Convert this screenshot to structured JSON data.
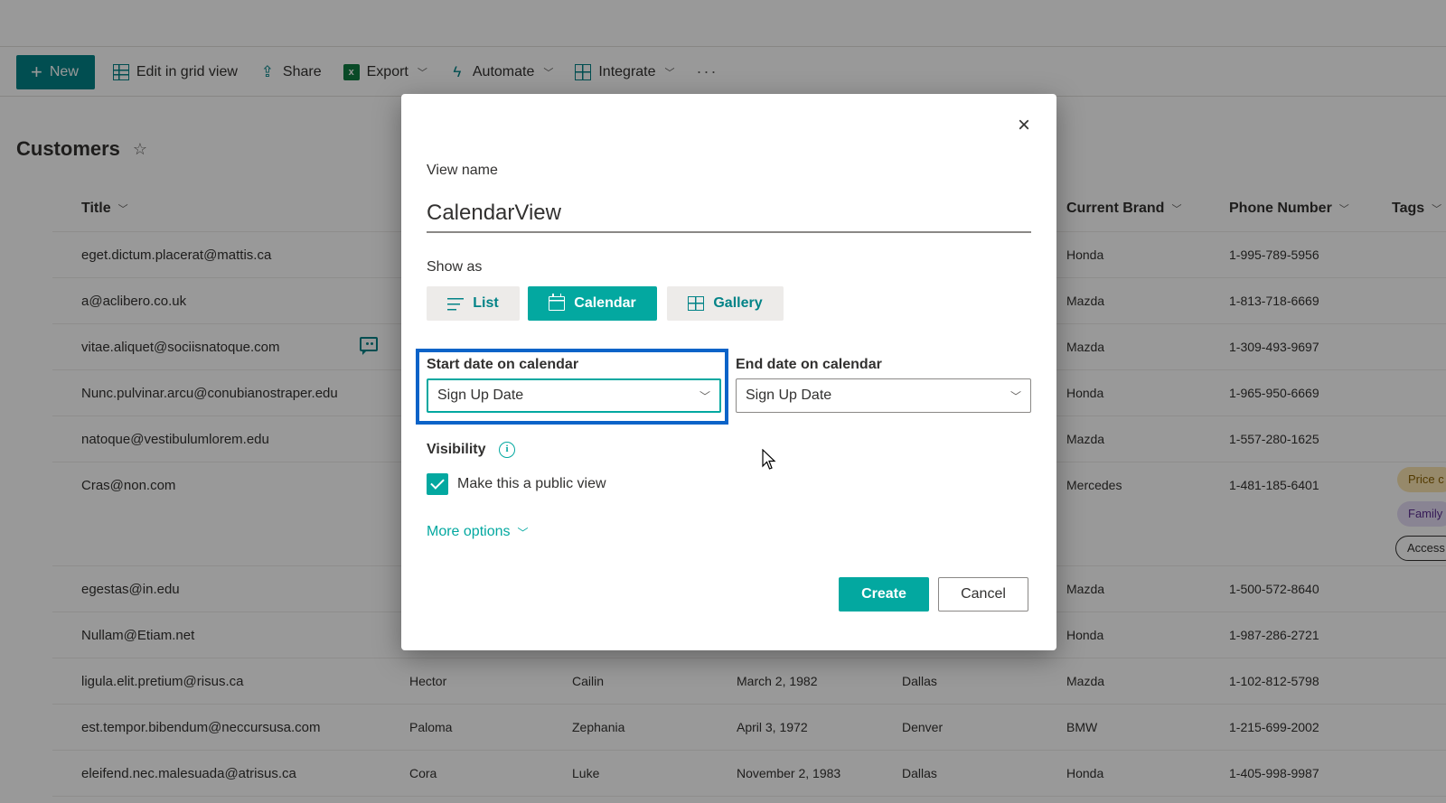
{
  "commandbar": {
    "new_label": "New",
    "edit_grid_label": "Edit in grid view",
    "share_label": "Share",
    "export_label": "Export",
    "automate_label": "Automate",
    "integrate_label": "Integrate",
    "more_label": "···"
  },
  "list": {
    "title": "Customers",
    "columns": {
      "title": "Title",
      "current_brand": "Current Brand",
      "phone_number": "Phone Number",
      "tags": "Tags"
    },
    "rows": [
      {
        "title": "eget.dictum.placerat@mattis.ca",
        "brand": "Honda",
        "phone": "1-995-789-5956"
      },
      {
        "title": "a@aclibero.co.uk",
        "brand": "Mazda",
        "phone": "1-813-718-6669"
      },
      {
        "title": "vitae.aliquet@sociisnatoque.com",
        "brand": "Mazda",
        "phone": "1-309-493-9697",
        "has_comment": true
      },
      {
        "title": "Nunc.pulvinar.arcu@conubianostraper.edu",
        "brand": "Honda",
        "phone": "1-965-950-6669"
      },
      {
        "title": "natoque@vestibulumlorem.edu",
        "brand": "Mazda",
        "phone": "1-557-280-1625"
      },
      {
        "title": "Cras@non.com",
        "brand": "Mercedes",
        "phone": "1-481-185-6401",
        "tags": [
          "Price c",
          "Family",
          "Access"
        ]
      },
      {
        "title": "egestas@in.edu",
        "brand": "Mazda",
        "phone": "1-500-572-8640"
      },
      {
        "title": "Nullam@Etiam.net",
        "brand": "Honda",
        "phone": "1-987-286-2721"
      },
      {
        "title": "ligula.elit.pretium@risus.ca",
        "first": "Hector",
        "last": "Cailin",
        "dob": "March 2, 1982",
        "city": "Dallas",
        "brand": "Mazda",
        "phone": "1-102-812-5798"
      },
      {
        "title": "est.tempor.bibendum@neccursusa.com",
        "first": "Paloma",
        "last": "Zephania",
        "dob": "April 3, 1972",
        "city": "Denver",
        "brand": "BMW",
        "phone": "1-215-699-2002"
      },
      {
        "title": "eleifend.nec.malesuada@atrisus.ca",
        "first": "Cora",
        "last": "Luke",
        "dob": "November 2, 1983",
        "city": "Dallas",
        "brand": "Honda",
        "phone": "1-405-998-9987"
      }
    ]
  },
  "dialog": {
    "close_label": "×",
    "view_name_label": "View name",
    "view_name_value": "CalendarView",
    "show_as_label": "Show as",
    "show_as_options": [
      {
        "label": "List",
        "selected": false
      },
      {
        "label": "Calendar",
        "selected": true
      },
      {
        "label": "Gallery",
        "selected": false
      }
    ],
    "start_date_label": "Start date on calendar",
    "start_date_value": "Sign Up Date",
    "end_date_label": "End date on calendar",
    "end_date_value": "Sign Up Date",
    "visibility_label": "Visibility",
    "public_view_label": "Make this a public view",
    "public_view_checked": true,
    "more_options_label": "More options",
    "create_label": "Create",
    "cancel_label": "Cancel"
  },
  "colors": {
    "accent": "#03a8a0",
    "brand_teal": "#038387",
    "highlight": "#0b63c8",
    "overlay": "rgba(0,0,0,0.4)"
  }
}
